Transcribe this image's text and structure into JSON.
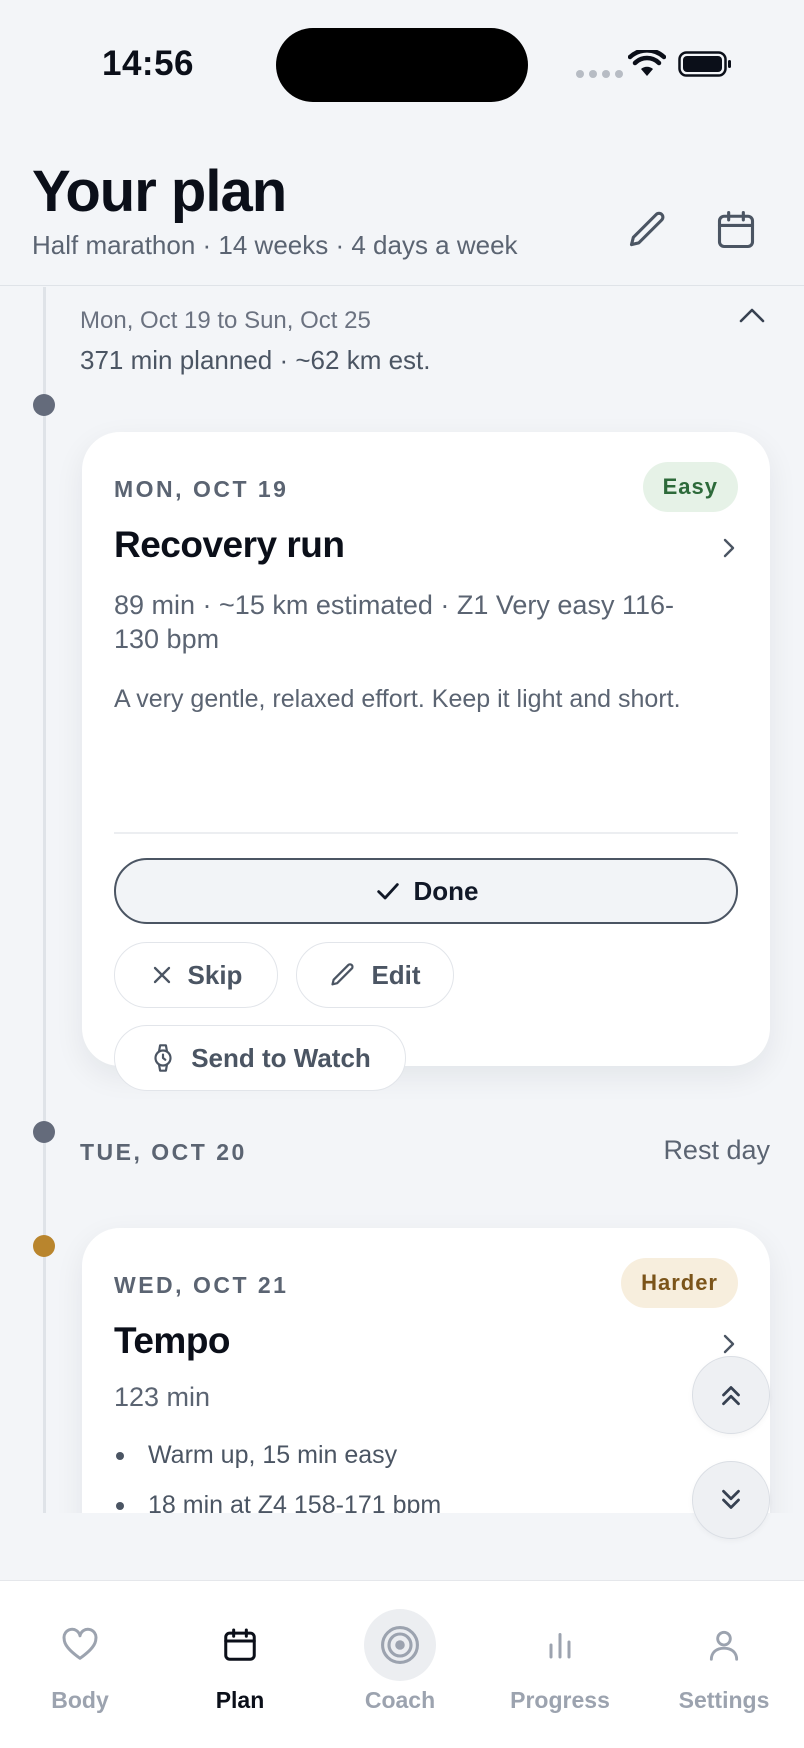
{
  "status_bar": {
    "time": "14:56"
  },
  "header": {
    "title": "Your plan",
    "subtitle": "Half marathon · 14 weeks · 4 days a week",
    "edit_icon": "pencil-icon",
    "calendar_icon": "calendar-icon"
  },
  "week": {
    "range": "Mon, Oct 19 to Sun, Oct 25",
    "summary": "371 min planned · ~62 km est."
  },
  "days": [
    {
      "date": "MON, OCT 19",
      "badge": "Easy",
      "title": "Recovery run",
      "meta": "89 min · ~15 km estimated · Z1 Very easy 116-130 bpm",
      "description": "A very gentle, relaxed effort. Keep it light and short.",
      "actions": {
        "done": "Done",
        "skip": "Skip",
        "edit": "Edit",
        "watch": "Send to Watch"
      }
    },
    {
      "date": "TUE, OCT 20",
      "rest": "Rest day"
    },
    {
      "date": "WED, OCT 21",
      "badge": "Harder",
      "title": "Tempo",
      "meta": "123 min",
      "steps": [
        "Warm up, 15 min easy",
        "18 min at Z4 158-171 bpm"
      ]
    }
  ],
  "colors": {
    "accent_dark": "#0b0f19",
    "easy_bg": "#e6f2e7",
    "easy_text": "#2d6a3a",
    "harder_bg": "#f7eedd",
    "harder_text": "#7b5419",
    "timeline_dot": "#646b7b",
    "timeline_dot_active": "#b9852d"
  },
  "tabs": [
    {
      "label": "Body",
      "icon": "heart-icon",
      "active": false
    },
    {
      "label": "Plan",
      "icon": "calendar-icon",
      "active": true
    },
    {
      "label": "Coach",
      "icon": "target-icon",
      "active": false
    },
    {
      "label": "Progress",
      "icon": "bar-chart-icon",
      "active": false
    },
    {
      "label": "Settings",
      "icon": "person-icon",
      "active": false
    }
  ]
}
